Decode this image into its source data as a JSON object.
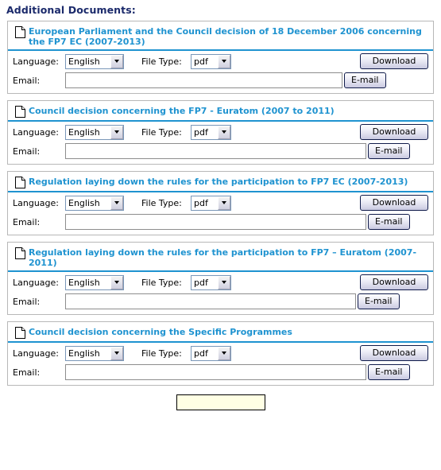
{
  "header": {
    "title": "Additional Documents:"
  },
  "labels": {
    "language": "Language:",
    "file_type": "File Type:",
    "email": "Email:",
    "download_button": "Download",
    "email_button": "E-mail"
  },
  "colors": {
    "header_title": "#1b2a6b",
    "doc_title_link": "#1f93d0",
    "panel_border": "#b8b8b8",
    "title_underline": "#1f93d0",
    "button_border": "#101b4a",
    "bottom_button_bg": "#ffffe4"
  },
  "form_defaults": {
    "language_value": "English",
    "language_options": [
      "English"
    ],
    "file_type_value": "pdf",
    "file_type_options": [
      "pdf"
    ],
    "email_value": "",
    "email_placeholder": ""
  },
  "documents": [
    {
      "icon": "document-icon",
      "title": "European Parliament and the Council decision of 18 December 2006 concerning the FP7 EC (2007-2013)",
      "language": "English",
      "file_type": "pdf",
      "email": "",
      "download_button": "Download",
      "email_button": "E-mail"
    },
    {
      "icon": "document-icon",
      "title": "Council decision concerning the FP7 - Euratom (2007 to 2011)",
      "language": "English",
      "file_type": "pdf",
      "email": "",
      "download_button": "Download",
      "email_button": "E-mail"
    },
    {
      "icon": "document-icon",
      "title": "Regulation laying down the rules for the participation to FP7 EC (2007-2013)",
      "language": "English",
      "file_type": "pdf",
      "email": "",
      "download_button": "Download",
      "email_button": "E-mail"
    },
    {
      "icon": "document-icon",
      "title": "Regulation laying down the rules for the participation to FP7 – Euratom (2007-2011)",
      "language": "English",
      "file_type": "pdf",
      "email": "",
      "download_button": "Download",
      "email_button": "E-mail"
    },
    {
      "icon": "document-icon",
      "title": "Council decision concerning the Specific Programmes",
      "language": "English",
      "file_type": "pdf",
      "email": "",
      "download_button": "Download",
      "email_button": "E-mail"
    }
  ],
  "bottom_button": {
    "label": ""
  }
}
